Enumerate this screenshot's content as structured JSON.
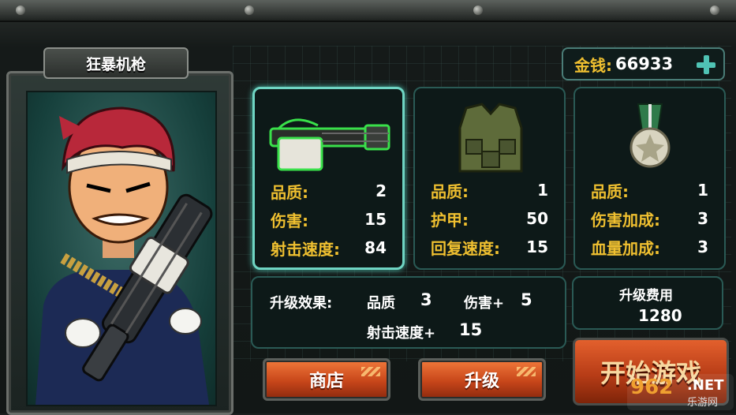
{
  "weapon_name": "狂暴机枪",
  "money": {
    "label": "金钱:",
    "value": "66933"
  },
  "cards": [
    {
      "stats": [
        {
          "label": "品质:",
          "value": "2"
        },
        {
          "label": "伤害:",
          "value": "15"
        },
        {
          "label": "射击速度:",
          "value": "84"
        }
      ]
    },
    {
      "stats": [
        {
          "label": "品质:",
          "value": "1"
        },
        {
          "label": "护甲:",
          "value": "50"
        },
        {
          "label": "回复速度:",
          "value": "15"
        }
      ]
    },
    {
      "stats": [
        {
          "label": "品质:",
          "value": "1"
        },
        {
          "label": "伤害加成:",
          "value": "3"
        },
        {
          "label": "血量加成:",
          "value": "3"
        }
      ]
    }
  ],
  "upgrade": {
    "title": "升级效果:",
    "quality_label": "品质",
    "quality_value": "3",
    "damage_label": "伤害+",
    "damage_value": "5",
    "speed_label": "射击速度+",
    "speed_value": "15"
  },
  "cost": {
    "label": "升级费用",
    "value": "1280"
  },
  "buttons": {
    "shop": "商店",
    "upgrade": "升级",
    "start": "开始游戏"
  },
  "watermark": {
    "logo": "962",
    "net": ".NET",
    "sub": "乐游网"
  }
}
